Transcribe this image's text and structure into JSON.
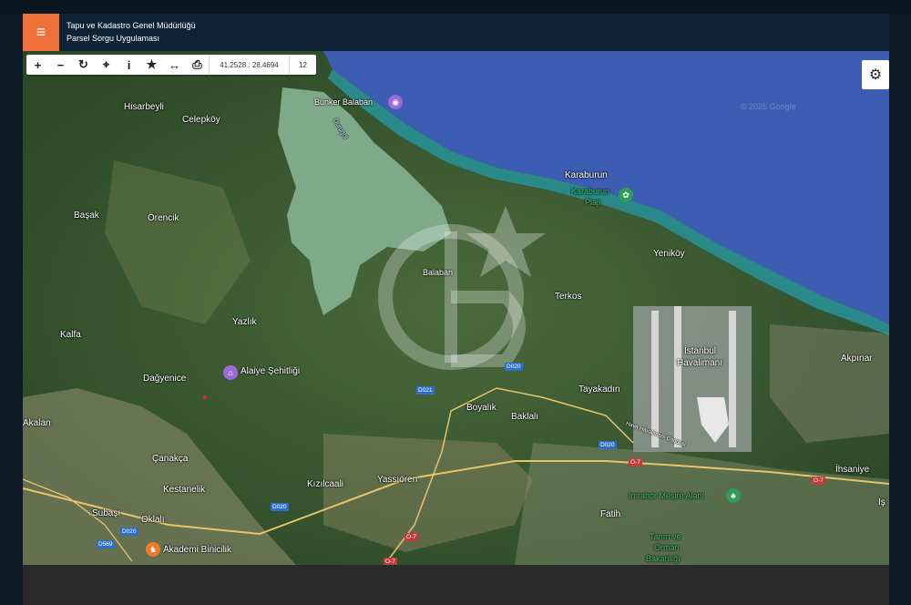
{
  "header": {
    "title_line1": "Tapu ve Kadastro Genel Müdürlüğü",
    "title_line2": "Parsel Sorgu Uygulaması",
    "menu_icon": "≡"
  },
  "toolbar": {
    "zoom_in_icon": "+",
    "zoom_out_icon": "−",
    "refresh_icon": "↻",
    "locate_icon": "⌖",
    "info_icon": "i",
    "favorite_icon": "★",
    "measure_icon": "↔",
    "print_icon": "⎙",
    "coordinates": "41.2528 : 28.4694",
    "zoom_level": "12"
  },
  "settings_icon": "⚙",
  "watermark": "© 2025 Google",
  "places": {
    "hisarbeyli": "Hisarbeyli",
    "celepkoy": "Celepköy",
    "bunker_balaban": "Bunker Balaban",
    "durugol": "Durugöl",
    "karaburun": "Karaburun",
    "karaburun_plaj_1": "Karaburun",
    "karaburun_plaj_2": "Plajı",
    "basak": "Başak",
    "orencik": "Örencik",
    "balaban": "Balaban",
    "yenikoy": "Yeniköy",
    "terkos": "Terkos",
    "yazlik": "Yazlık",
    "kalfa": "Kalfa",
    "istanbul_havalimani_1": "İstanbul",
    "istanbul_havalimani_2": "Havalimanı",
    "akpinar": "Akpınar",
    "dagyenice": "Dağyenice",
    "alaiye_sehitligi": "Alaiye Şehitliği",
    "tayakadin": "Tayakadın",
    "akalan": "Akalan",
    "boyalik": "Boyalık",
    "baklali": "Baklalı",
    "canakca": "Çanakça",
    "ihsaniye": "İhsaniye",
    "kizilcaali": "Kızılcaali",
    "yassioren": "Yassıören",
    "kestanelik": "Kestanelik",
    "imrahor": "İmrahor Mesire Alanı",
    "subasi": "Subaşı",
    "oklali": "Oklalı",
    "fatih": "Fatih",
    "akademi": "Akademi Binicilik",
    "tarim_1": "Tarım ve",
    "tarim_2": "Orman",
    "tarim_3": "Bakanlığı",
    "havalimani_cad": "Hava Havalimanı Caddesi",
    "isi": "Iş"
  },
  "roads": {
    "d020_a": "D020",
    "d020_b": "D020",
    "d021": "D021",
    "d020_c": "D020",
    "d020_d": "D020",
    "d020_e": "D020",
    "d569": "D569",
    "o7_a": "O-7",
    "o7_b": "O-7",
    "o7_c": "O-7",
    "o7_d": "O-7"
  },
  "colors": {
    "header_bg": "#0e2336",
    "menu_accent": "#f0703a",
    "sea": "#3a5cb0",
    "forest": "#34552e",
    "lake": "#7faa8a"
  }
}
